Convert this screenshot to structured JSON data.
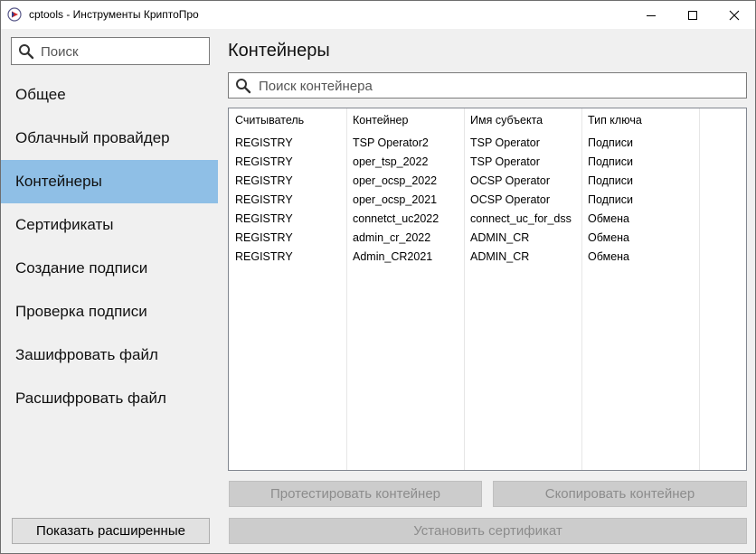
{
  "window": {
    "title": "cptools - Инструменты КриптоПро",
    "icon": "cryptopro-app-icon"
  },
  "sidebar": {
    "search_placeholder": "Поиск",
    "items": [
      {
        "label": "Общее",
        "active": false
      },
      {
        "label": "Облачный провайдер",
        "active": false
      },
      {
        "label": "Контейнеры",
        "active": true
      },
      {
        "label": "Сертификаты",
        "active": false
      },
      {
        "label": "Создание подписи",
        "active": false
      },
      {
        "label": "Проверка подписи",
        "active": false
      },
      {
        "label": "Зашифровать файл",
        "active": false
      },
      {
        "label": "Расшифровать файл",
        "active": false
      }
    ],
    "advanced_button": "Показать расширенные"
  },
  "main": {
    "title": "Контейнеры",
    "search_placeholder": "Поиск контейнера",
    "table": {
      "columns": [
        "Считыватель",
        "Контейнер",
        "Имя субъекта",
        "Тип ключа"
      ],
      "rows": [
        [
          "REGISTRY",
          "TSP Operator2",
          "TSP Operator",
          "Подписи"
        ],
        [
          "REGISTRY",
          "oper_tsp_2022",
          "TSP Operator",
          "Подписи"
        ],
        [
          "REGISTRY",
          "oper_ocsp_2022",
          "OCSP Operator",
          "Подписи"
        ],
        [
          "REGISTRY",
          "oper_ocsp_2021",
          "OCSP Operator",
          "Подписи"
        ],
        [
          "REGISTRY",
          "connetct_uc2022",
          "connect_uc_for_dss",
          "Обмена"
        ],
        [
          "REGISTRY",
          "admin_cr_2022",
          "ADMIN_CR",
          "Обмена"
        ],
        [
          "REGISTRY",
          "Admin_CR2021",
          "ADMIN_CR",
          "Обмена"
        ]
      ]
    },
    "buttons": {
      "test": "Протестировать контейнер",
      "copy": "Скопировать контейнер",
      "install": "Установить сертификат"
    }
  },
  "colors": {
    "active_nav": "#8fbfe6",
    "disabled_button": "#cccccc",
    "disabled_text": "#8c8c8c"
  }
}
